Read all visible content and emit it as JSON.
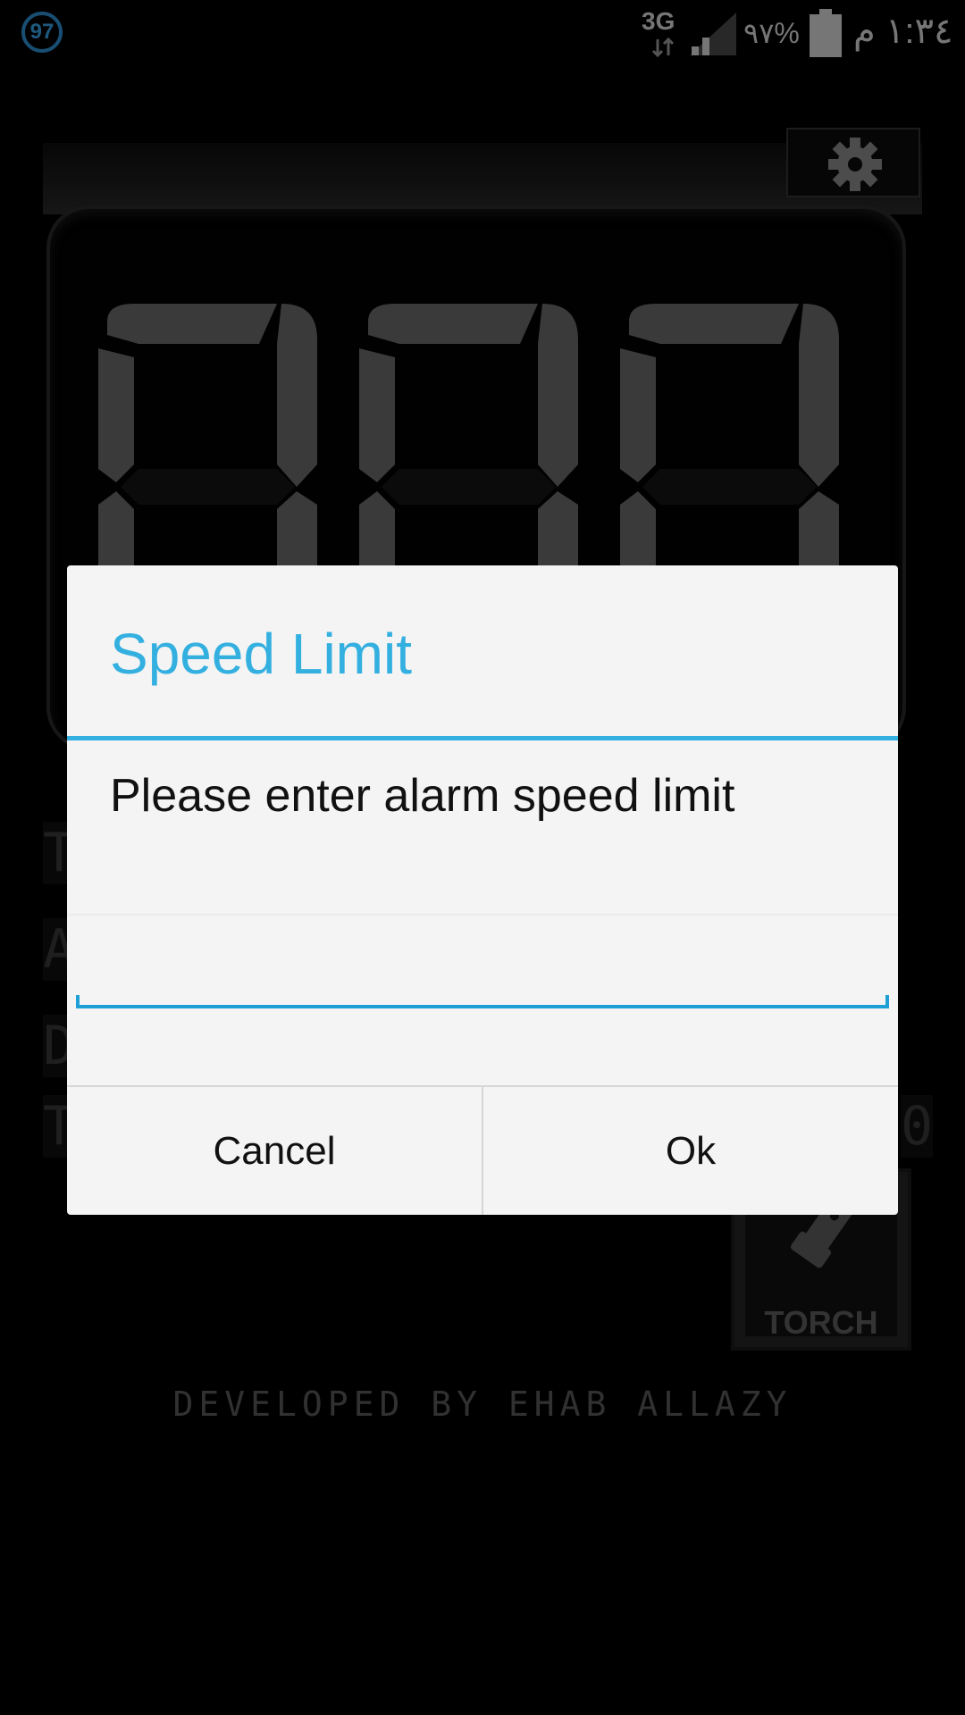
{
  "status_bar": {
    "notification_count": "97",
    "network_type": "3G",
    "battery_percent": "٩٧%",
    "clock": "١:٣٤ م",
    "icons": [
      "notification-badge-icon",
      "data-arrows-icon",
      "signal-icon",
      "battery-icon"
    ]
  },
  "speedometer": {
    "digits_display": "000",
    "settings_icon": "gear-icon",
    "side_labels": [
      "T",
      "A",
      "D",
      "T"
    ],
    "right_label": "0"
  },
  "torch": {
    "label": "TORCH",
    "icon": "flashlight-icon"
  },
  "footer": {
    "credit": "DEVELOPED BY EHAB ALLAZY"
  },
  "dialog": {
    "title": "Speed Limit",
    "message": "Please enter alarm speed limit",
    "input_value": "",
    "input_placeholder": "",
    "cancel_label": "Cancel",
    "ok_label": "Ok"
  },
  "colors": {
    "accent": "#34b0e0",
    "underline": "#1e9fd5",
    "background": "#000000",
    "dialog_bg": "#f4f4f4",
    "lcd_segment": "#6a6a6a"
  }
}
